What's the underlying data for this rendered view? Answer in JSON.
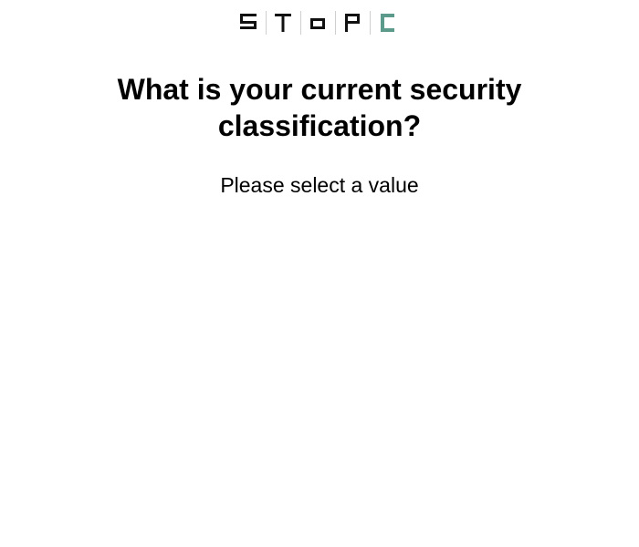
{
  "brand": {
    "letters": [
      "S",
      "T",
      "O",
      "P",
      "C"
    ],
    "letter_color": "#111111",
    "accent_color": "#5c9a8b",
    "divider_color": "#cfcfcf"
  },
  "question": {
    "title": "What is your current security classification?",
    "prompt": "Please select a value"
  }
}
